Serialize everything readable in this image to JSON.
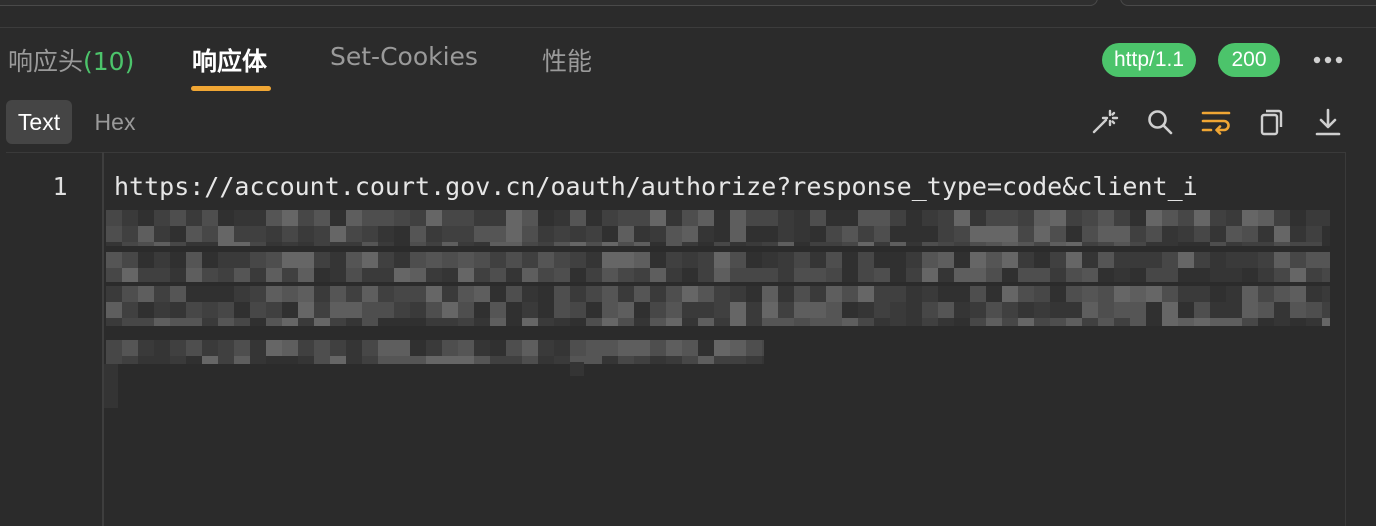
{
  "tabs": [
    {
      "label": "响应头",
      "count": "(10)"
    },
    {
      "label": "响应体"
    },
    {
      "label": "Set-Cookies"
    },
    {
      "label": "性能"
    }
  ],
  "status": {
    "protocol": "http/1.1",
    "code": "200"
  },
  "format": {
    "active": "Text",
    "other": "Hex"
  },
  "toolbar_icons": [
    "magic-wand-icon",
    "search-icon",
    "wrap-lines-icon",
    "copy-icon",
    "download-icon"
  ],
  "editor": {
    "line_number": "1",
    "line_text": "https://account.court.gov.cn/oauth/authorize?response_type=code&client_i"
  },
  "colors": {
    "background": "#2b2b2b",
    "accent": "#f0a634",
    "success": "#4cc46b",
    "active_tab_text": "#ffffff",
    "inactive_tab_text": "#9a9a9a"
  }
}
